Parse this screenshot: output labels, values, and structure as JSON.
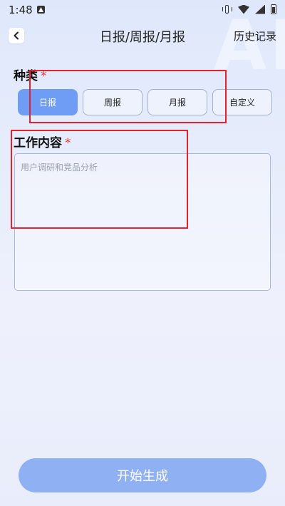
{
  "status_bar": {
    "time": "1:48",
    "app_icon": "letter-a-icon",
    "icons": [
      "vibrate-icon",
      "wifi-icon",
      "signal-icon",
      "battery-icon"
    ]
  },
  "header": {
    "back_icon": "chevron-left-icon",
    "title": "日报/周报/月报",
    "history_label": "历史记录"
  },
  "watermark": "AI",
  "category": {
    "label": "种类",
    "required_mark": "*",
    "options": [
      "日报",
      "周报",
      "月报",
      "自定义"
    ],
    "selected": "日报"
  },
  "work_content": {
    "label": "工作内容",
    "required_mark": "*",
    "placeholder": "用户调研和竞品分析",
    "value": ""
  },
  "generate_button": {
    "label": "开始生成"
  },
  "colors": {
    "accent": "#6f9df5",
    "button": "#8fb1f3",
    "required": "#e53935",
    "annotation": "#e5222a"
  }
}
